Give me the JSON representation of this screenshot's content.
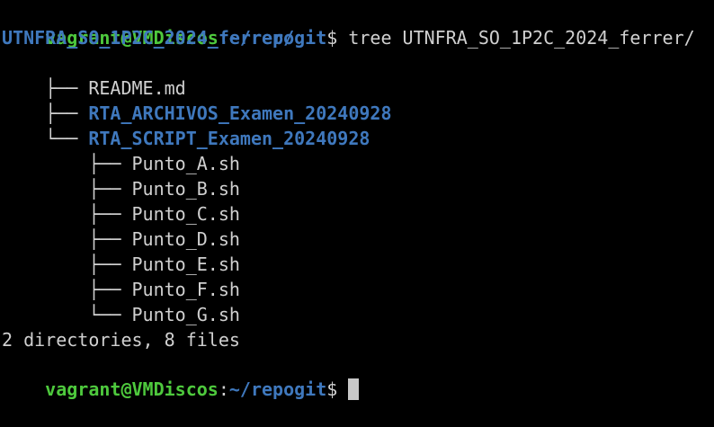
{
  "colors": {
    "background": "#000000",
    "prompt_user": "#4ec93d",
    "prompt_path": "#3f78bd",
    "directory": "#3f78bd",
    "text": "#d0d0d0",
    "cursor": "#c8c8c8"
  },
  "prompt": {
    "user_host": "vagrant@VMDiscos",
    "separator": ":",
    "cwd": "~/repogit",
    "symbol": "$"
  },
  "command": " tree UTNFRA_SO_1P2C_2024_ferrer/",
  "tree": {
    "root": "UTNFRA_SO_1P2C_2024_ferrer/",
    "entries": [
      {
        "branch": "├── ",
        "name": "README.md",
        "type": "file"
      },
      {
        "branch": "├── ",
        "name": "RTA_ARCHIVOS_Examen_20240928",
        "type": "dir"
      },
      {
        "branch": "└── ",
        "name": "RTA_SCRIPT_Examen_20240928",
        "type": "dir"
      },
      {
        "branch": "    ├── ",
        "name": "Punto_A.sh",
        "type": "file"
      },
      {
        "branch": "    ├── ",
        "name": "Punto_B.sh",
        "type": "file"
      },
      {
        "branch": "    ├── ",
        "name": "Punto_C.sh",
        "type": "file"
      },
      {
        "branch": "    ├── ",
        "name": "Punto_D.sh",
        "type": "file"
      },
      {
        "branch": "    ├── ",
        "name": "Punto_E.sh",
        "type": "file"
      },
      {
        "branch": "    ├── ",
        "name": "Punto_F.sh",
        "type": "file"
      },
      {
        "branch": "    └── ",
        "name": "Punto_G.sh",
        "type": "file"
      }
    ],
    "summary": "2 directories, 8 files"
  }
}
